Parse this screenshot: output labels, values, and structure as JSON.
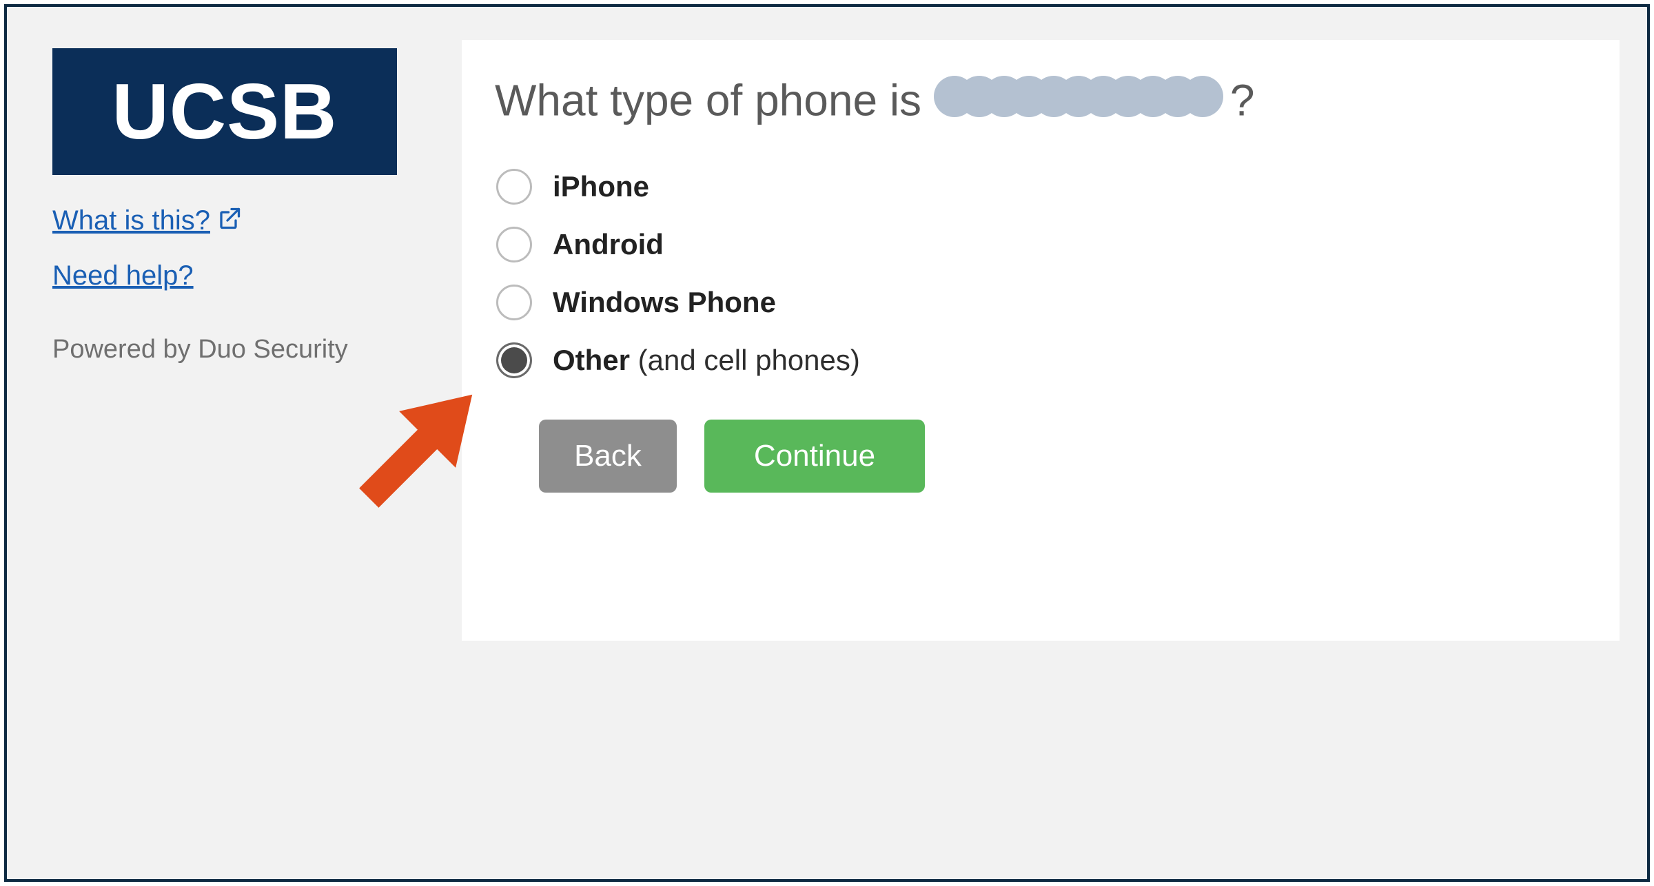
{
  "sidebar": {
    "logo_text": "UCSB",
    "what_link": "What is this?",
    "help_link": "Need help?",
    "powered_by": "Powered by Duo Security"
  },
  "panel": {
    "title_prefix": "What type of phone is ",
    "title_suffix": "?",
    "options": [
      {
        "label": "iPhone",
        "suffix": "",
        "selected": false
      },
      {
        "label": "Android",
        "suffix": "",
        "selected": false
      },
      {
        "label": "Windows Phone",
        "suffix": "",
        "selected": false
      },
      {
        "label": "Other",
        "suffix": " (and cell phones)",
        "selected": true
      }
    ],
    "back_label": "Back",
    "continue_label": "Continue"
  },
  "colors": {
    "brand_navy": "#0b2e58",
    "link_blue": "#1a5fb4",
    "btn_green": "#59b85a",
    "btn_grey": "#8e8e8e",
    "annotation_orange": "#e04b1a",
    "redaction": "#b4c1d1"
  }
}
